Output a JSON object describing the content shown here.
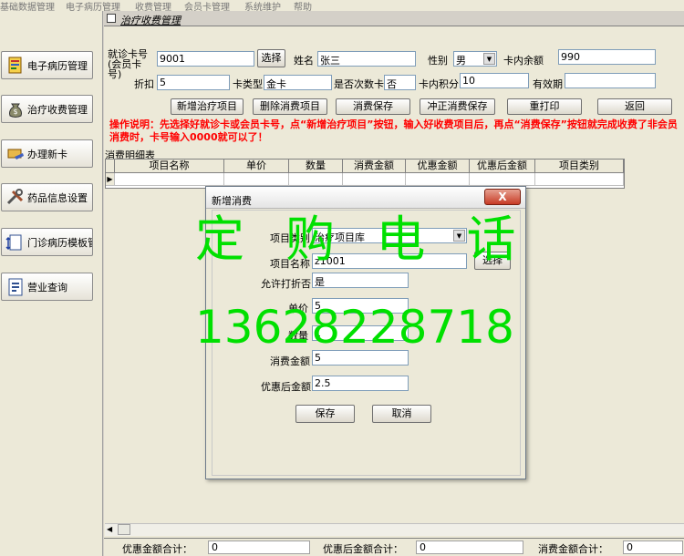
{
  "menu": [
    "基础数据管理",
    "电子病历管理",
    "收费管理",
    "会员卡管理",
    "系统维护",
    "帮助"
  ],
  "sidebar": {
    "items": [
      {
        "label": "电子病历管理",
        "icon": "medical-record-icon"
      },
      {
        "label": "治疗收费管理",
        "icon": "money-bag-icon"
      },
      {
        "label": "办理新卡",
        "icon": "card-hand-icon"
      },
      {
        "label": "药品信息设置",
        "icon": "tools-icon"
      },
      {
        "label": "门诊病历模板管理",
        "icon": "template-icon"
      },
      {
        "label": "营业查询",
        "icon": "report-icon"
      }
    ]
  },
  "window": {
    "title": "治疗收费管理"
  },
  "form": {
    "card_label": "就诊卡号(会员卡号)",
    "card_value": "9001",
    "select_label": "选择",
    "name_label": "姓名",
    "name_value": "张三",
    "gender_label": "性别",
    "gender_value": "男",
    "balance_label": "卡内余额",
    "balance_value": "990",
    "discount_label": "折扣",
    "discount_value": "5",
    "card_type_label": "卡类型",
    "card_type_value": "金卡",
    "per_use_label": "是否次数卡",
    "per_use_value": "否",
    "points_label": "卡内积分",
    "points_value": "10",
    "expiry_label": "有效期",
    "expiry_value": ""
  },
  "toolbar": {
    "add": "新增治疗项目",
    "delete": "删除消费项目",
    "save": "消费保存",
    "reverse": "冲正消费保存",
    "reprint": "重打印",
    "back": "返回"
  },
  "notice": "操作说明：先选择好就诊卡或会员卡号，点“新增治疗项目”按钮，输入好收费项目后，再点“消费保存”按钮就完成收费了非会员消费时，卡号输入0000就可以了！",
  "grid": {
    "title": "消费明细表",
    "columns": [
      "项目名称",
      "单价",
      "数量",
      "消费金额",
      "优惠金额",
      "优惠后金额",
      "项目类别"
    ]
  },
  "footer": {
    "discount_total_label": "优惠金额合计：",
    "discount_total_value": "0",
    "after_total_label": "优惠后金额合计：",
    "after_total_value": "0",
    "spend_total_label": "消费金额合计：",
    "spend_total_value": "0"
  },
  "dialog": {
    "title": "新增消费",
    "close": "X",
    "category_label": "项目类别",
    "category_value": "治疗项目库",
    "item_name_label": "项目名称",
    "item_name_value": "z1001",
    "select_button": "选择",
    "allow_discount_label": "允许打折否",
    "allow_discount_value": "是",
    "price_label": "单价",
    "price_value": "5",
    "qty_label": "数量",
    "qty_value": "1",
    "amount_label": "消费金额",
    "amount_value": "5",
    "after_label": "优惠后金额",
    "after_value": "2.5",
    "save_button": "保存",
    "cancel_button": "取消"
  },
  "watermark": {
    "line1": "定 购 电 话",
    "line2": "13628228718"
  }
}
